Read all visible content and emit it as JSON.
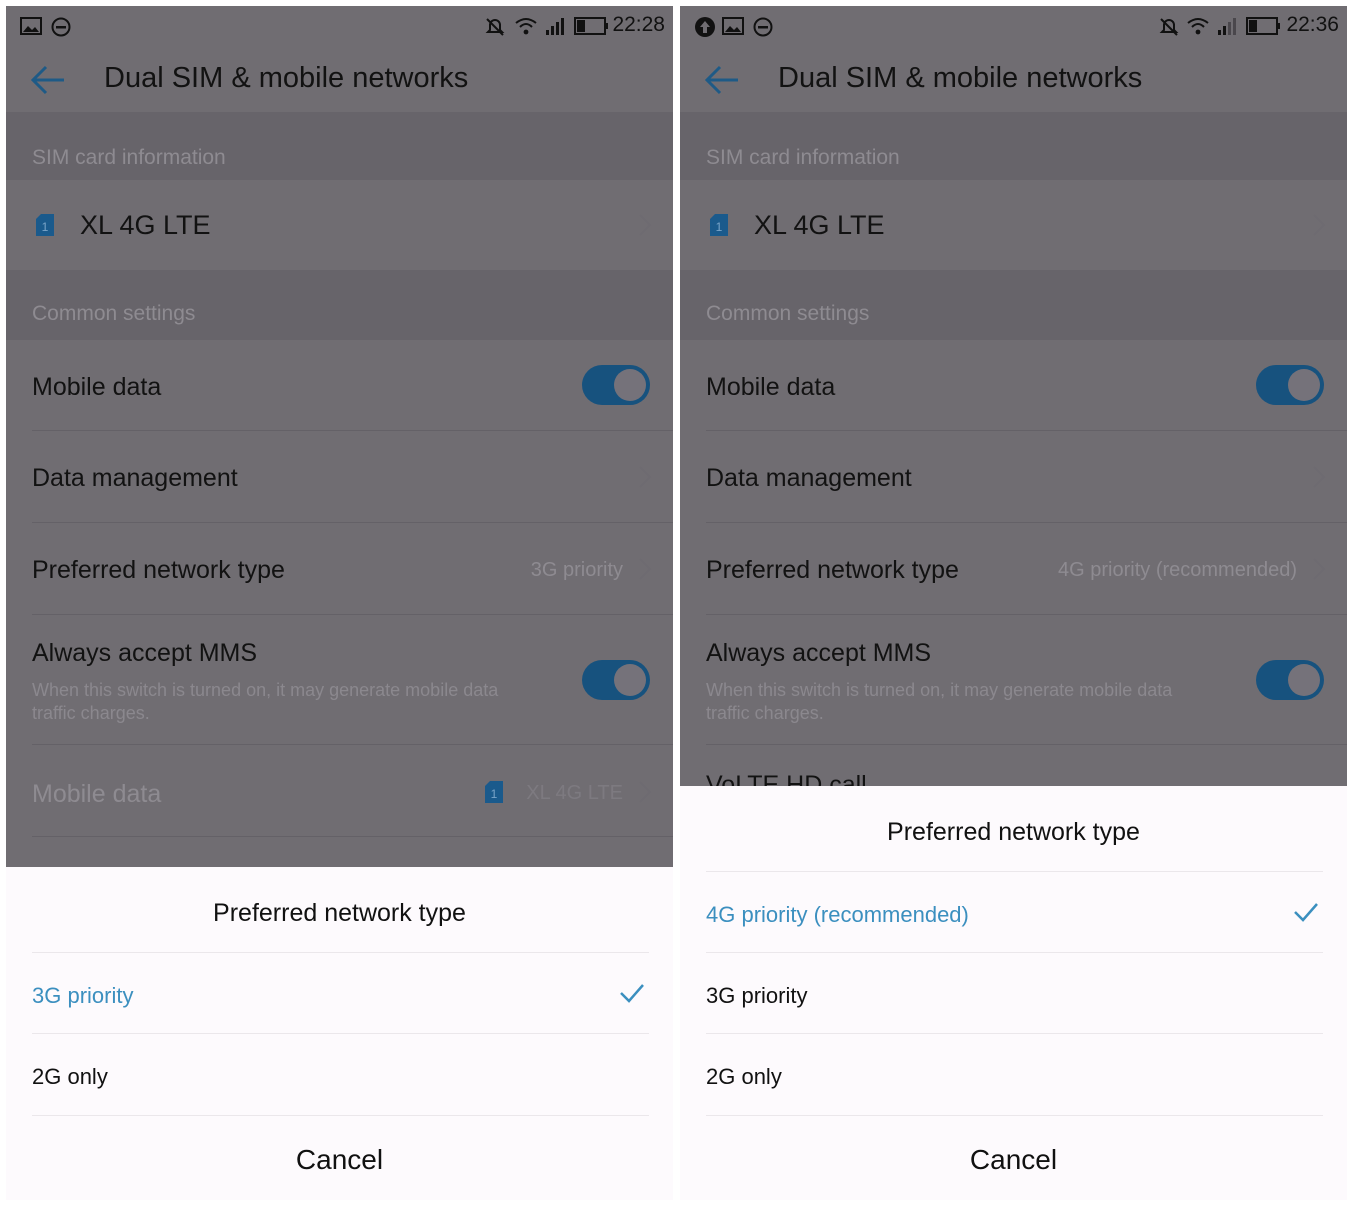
{
  "left": {
    "status_time": "22:28",
    "title": "Dual SIM & mobile networks",
    "section_sim": "SIM card information",
    "sim_name": "XL 4G LTE",
    "sim_badge": "1",
    "section_common": "Common settings",
    "mobile_data": "Mobile data",
    "data_management": "Data management",
    "preferred_network": "Preferred network type",
    "preferred_value": "3G priority",
    "mms_title": "Always accept MMS",
    "mms_sub": "When this switch is turned on, it may generate mobile data traffic charges.",
    "mobile_data_sim_label": "Mobile data",
    "mobile_data_sim_value": "XL 4G LTE",
    "mobile_data_toggle_on": true,
    "mms_toggle_on": true,
    "sheet": {
      "title": "Preferred network type",
      "options": [
        "3G priority",
        "2G only"
      ],
      "selected": "3G priority",
      "cancel": "Cancel"
    }
  },
  "right": {
    "status_time": "22:36",
    "title": "Dual SIM & mobile networks",
    "section_sim": "SIM card information",
    "sim_name": "XL 4G LTE",
    "sim_badge": "1",
    "section_common": "Common settings",
    "mobile_data": "Mobile data",
    "data_management": "Data management",
    "preferred_network": "Preferred network type",
    "preferred_value": "4G priority (recommended)",
    "mms_title": "Always accept MMS",
    "mms_sub": "When this switch is turned on, it may generate mobile data traffic charges.",
    "volte_partial": "VoLTE HD call",
    "mobile_data_toggle_on": true,
    "mms_toggle_on": true,
    "sheet": {
      "title": "Preferred network type",
      "options": [
        "4G priority (recommended)",
        "3G priority",
        "2G only"
      ],
      "selected": "4G priority (recommended)",
      "cancel": "Cancel"
    }
  },
  "colors": {
    "accent": "#3b8fbf",
    "toggle_on": "#17527e",
    "dim_overlay": "#706d72",
    "sheet_bg": "#fdfafd"
  },
  "icons": [
    "image-icon",
    "do-not-disturb-icon",
    "upload-icon",
    "silent-icon",
    "wifi-icon",
    "signal-icon",
    "battery-icon",
    "back-arrow-icon",
    "sim-card-icon",
    "chevron-right-icon",
    "checkmark-icon"
  ]
}
